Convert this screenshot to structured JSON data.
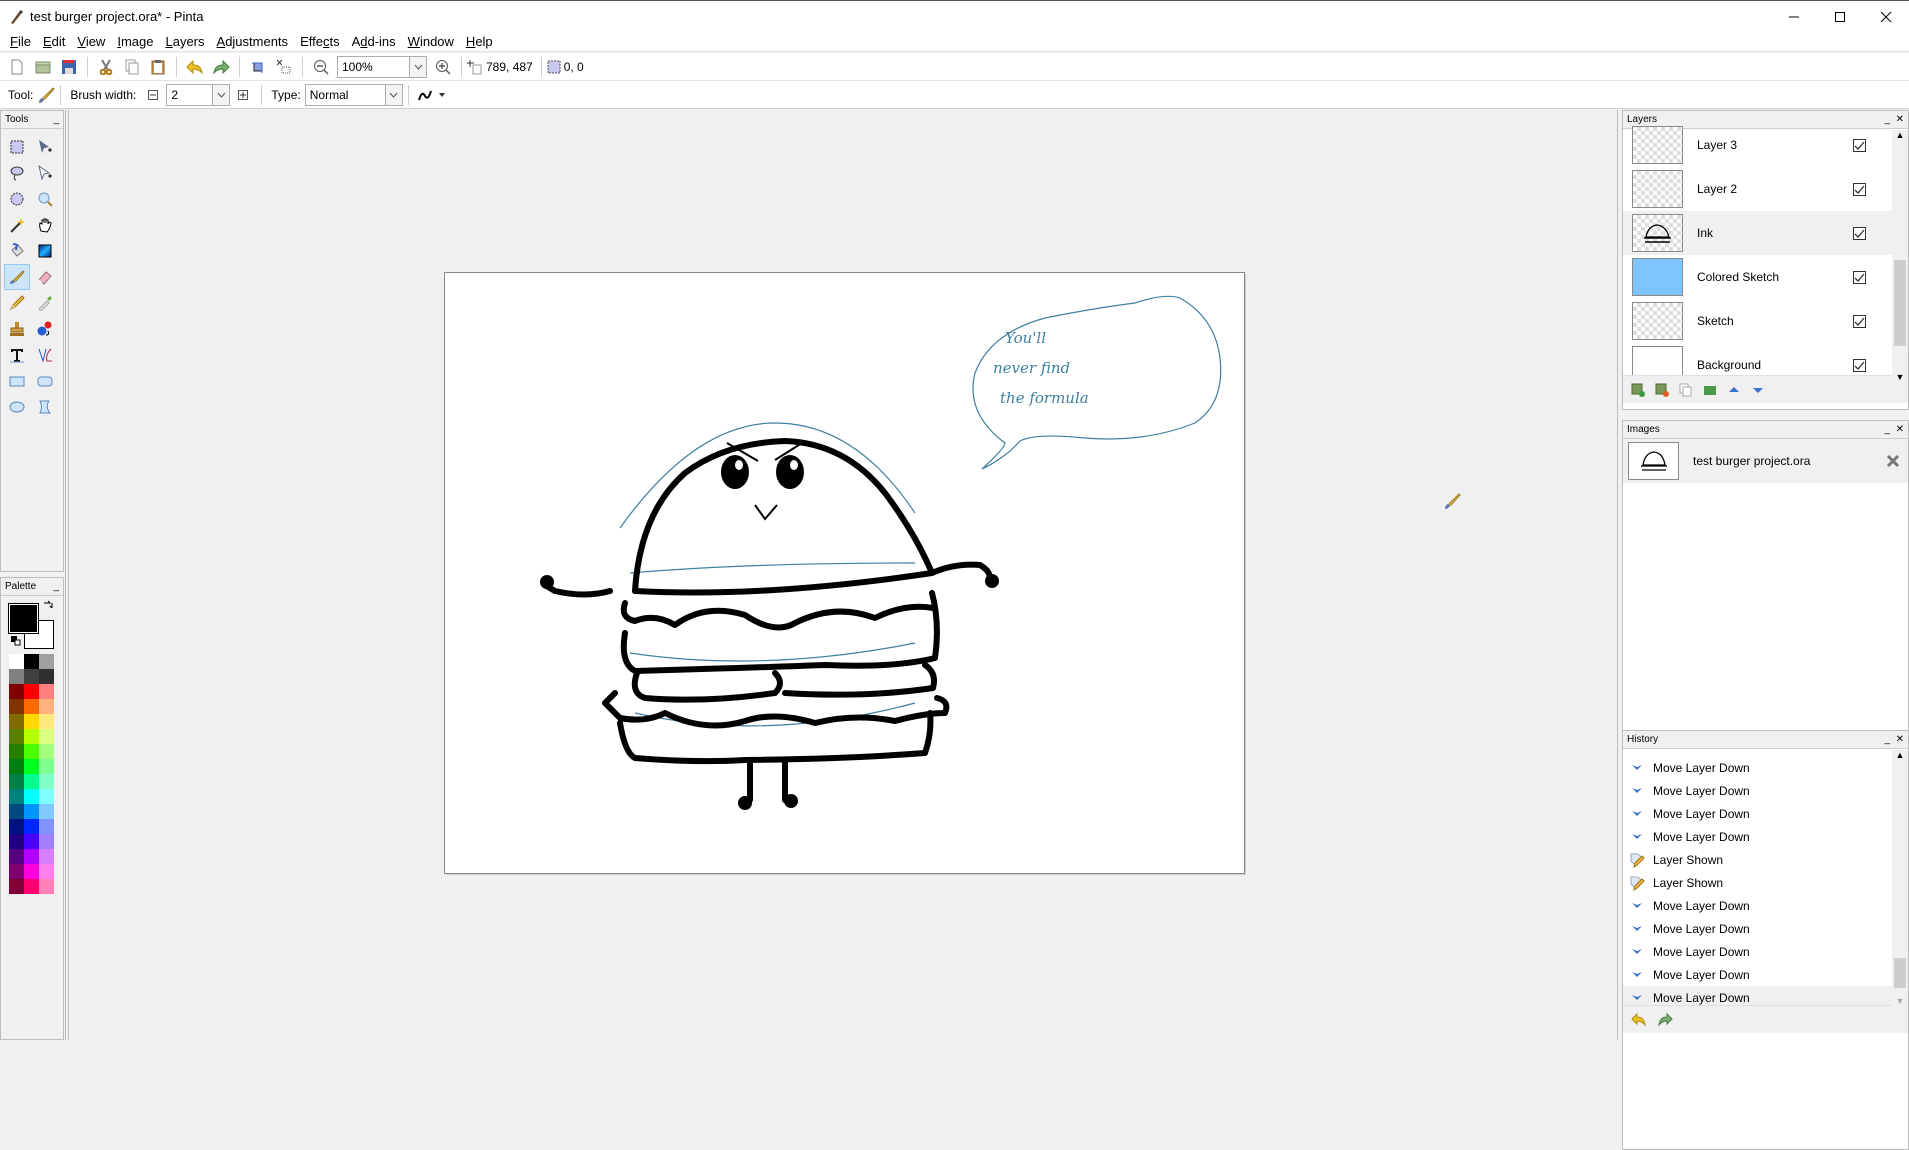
{
  "window": {
    "title": "test burger project.ora* - Pinta",
    "controls": [
      "minimize",
      "maximize",
      "close"
    ]
  },
  "menu": [
    {
      "label": "File",
      "accel": "F"
    },
    {
      "label": "Edit",
      "accel": "E"
    },
    {
      "label": "View",
      "accel": "V"
    },
    {
      "label": "Image",
      "accel": "I"
    },
    {
      "label": "Layers",
      "accel": "L"
    },
    {
      "label": "Adjustments",
      "accel": "A"
    },
    {
      "label": "Effects",
      "accel": "c"
    },
    {
      "label": "Add-ins",
      "accel": "d"
    },
    {
      "label": "Window",
      "accel": "W"
    },
    {
      "label": "Help",
      "accel": "H"
    }
  ],
  "toolbar": {
    "buttons": [
      "new-file",
      "open-file",
      "save-file",
      "cut",
      "copy",
      "paste",
      "undo",
      "redo",
      "crop-to-selection",
      "deselect",
      "zoom-out",
      "zoom-in"
    ],
    "zoom_value": "100%",
    "cursor_position": "789, 487",
    "selection_size": "0, 0"
  },
  "tool_options": {
    "tool_label": "Tool:",
    "brush_width_label": "Brush width:",
    "brush_width_value": "2",
    "type_label": "Type:",
    "type_value": "Normal"
  },
  "tools_panel": {
    "title": "Tools",
    "tools": [
      {
        "name": "rectangle-select"
      },
      {
        "name": "move-selected"
      },
      {
        "name": "lasso-select"
      },
      {
        "name": "move-selection"
      },
      {
        "name": "ellipse-select"
      },
      {
        "name": "zoom"
      },
      {
        "name": "magic-wand"
      },
      {
        "name": "pan"
      },
      {
        "name": "paint-bucket"
      },
      {
        "name": "gradient"
      },
      {
        "name": "paintbrush",
        "active": true
      },
      {
        "name": "eraser"
      },
      {
        "name": "pencil"
      },
      {
        "name": "color-picker"
      },
      {
        "name": "clone-stamp"
      },
      {
        "name": "recolor"
      },
      {
        "name": "text"
      },
      {
        "name": "line-curve"
      },
      {
        "name": "rectangle"
      },
      {
        "name": "rounded-rectangle"
      },
      {
        "name": "ellipse"
      },
      {
        "name": "freeform-shape"
      }
    ]
  },
  "palette_panel": {
    "title": "Palette",
    "primary_color": "#000000",
    "secondary_color": "#ffffff",
    "swatches": [
      "#ffffff",
      "#000000",
      "#a0a0a0",
      "#808080",
      "#404040",
      "#303030",
      "#7f0000",
      "#ff0000",
      "#ff7f7f",
      "#7f3300",
      "#ff6a00",
      "#ffb27f",
      "#7f6a00",
      "#ffd800",
      "#ffe97f",
      "#5b7f00",
      "#b6ff00",
      "#daff7f",
      "#267f00",
      "#4cff00",
      "#a5ff7f",
      "#007f0e",
      "#00ff21",
      "#7fff8e",
      "#007f46",
      "#00ff90",
      "#7fffc5",
      "#007f7f",
      "#00ffff",
      "#7fffff",
      "#004a7f",
      "#0094ff",
      "#7fc9ff",
      "#00137f",
      "#0026ff",
      "#7f92ff",
      "#21007f",
      "#4800ff",
      "#a17fff",
      "#57007f",
      "#b200ff",
      "#d67fff",
      "#7f006e",
      "#ff00dc",
      "#ff7fed",
      "#7f0037",
      "#ff006e",
      "#ff7fb6"
    ]
  },
  "canvas": {
    "speech_bubble_text": "You'll never find the formula",
    "ink_color": "#000000",
    "sketch_color": "#3f7f9f"
  },
  "layers_panel": {
    "title": "Layers",
    "layers": [
      {
        "name": "Layer 3",
        "visible": true,
        "thumb": "transparent"
      },
      {
        "name": "Layer 2",
        "visible": true,
        "thumb": "transparent"
      },
      {
        "name": "Ink",
        "visible": true,
        "thumb": "ink",
        "selected": true
      },
      {
        "name": "Colored Sketch",
        "visible": true,
        "thumb": "blue"
      },
      {
        "name": "Sketch",
        "visible": true,
        "thumb": "transparent"
      },
      {
        "name": "Background",
        "visible": true,
        "thumb": "white"
      }
    ],
    "footer_buttons": [
      "add-new-layer",
      "delete-layer",
      "duplicate-layer",
      "merge-layer-down",
      "move-layer-up",
      "move-layer-down"
    ],
    "thumb_blue": "#80c4ff"
  },
  "images_panel": {
    "title": "Images",
    "images": [
      {
        "name": "test burger project.ora"
      }
    ]
  },
  "history_panel": {
    "title": "History",
    "items": [
      {
        "label": "Move Layer Down",
        "icon": "move-layer-down"
      },
      {
        "label": "Move Layer Down",
        "icon": "move-layer-down"
      },
      {
        "label": "Move Layer Down",
        "icon": "move-layer-down"
      },
      {
        "label": "Move Layer Down",
        "icon": "move-layer-down"
      },
      {
        "label": "Layer Shown",
        "icon": "layer-properties"
      },
      {
        "label": "Layer Shown",
        "icon": "layer-properties"
      },
      {
        "label": "Move Layer Down",
        "icon": "move-layer-down"
      },
      {
        "label": "Move Layer Down",
        "icon": "move-layer-down"
      },
      {
        "label": "Move Layer Down",
        "icon": "move-layer-down"
      },
      {
        "label": "Move Layer Down",
        "icon": "move-layer-down"
      },
      {
        "label": "Move Layer Down",
        "icon": "move-layer-down",
        "selected": true
      }
    ],
    "footer_buttons": [
      "undo",
      "redo"
    ]
  }
}
